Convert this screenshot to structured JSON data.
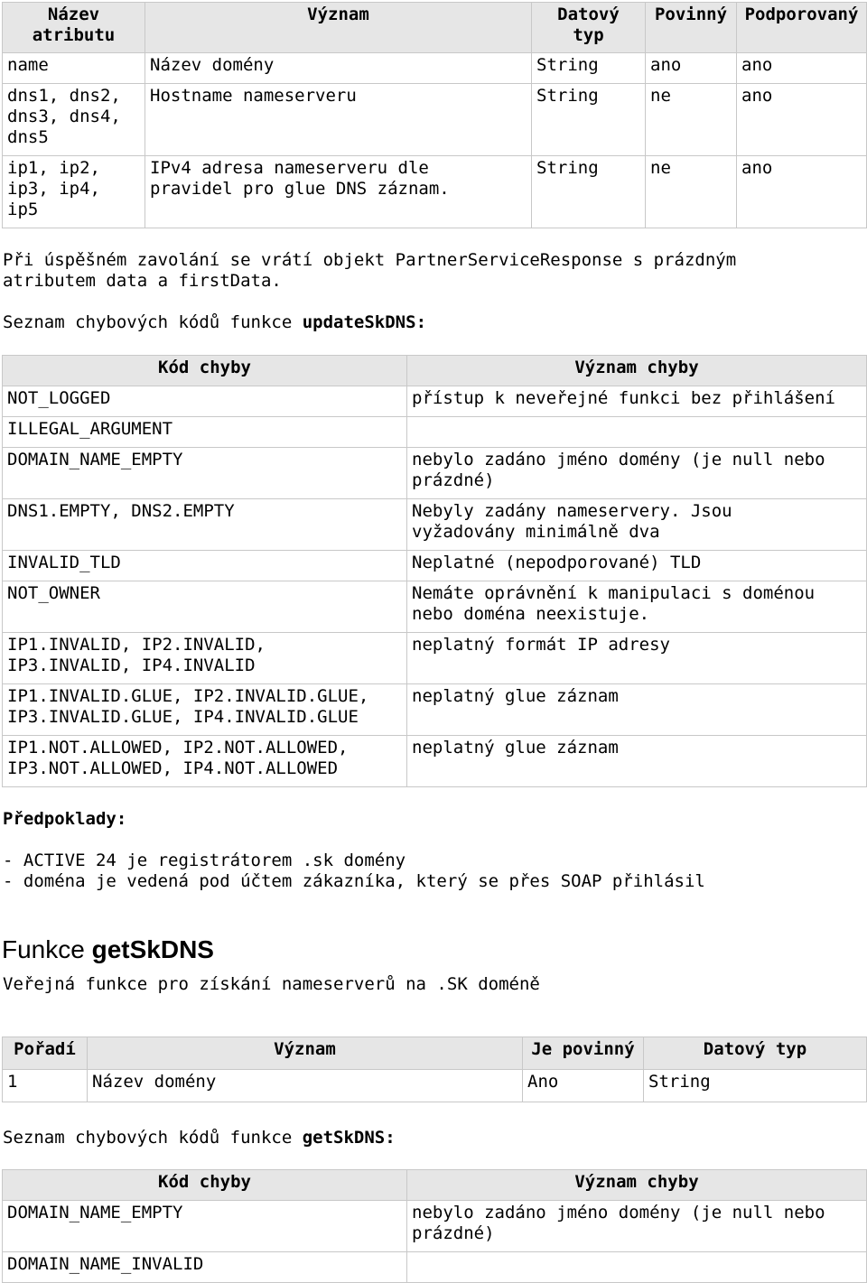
{
  "params_table": {
    "headers": [
      "Název\natributu",
      "Význam",
      "Datový\ntyp",
      "Povinný",
      "Podporovaný"
    ],
    "rows": [
      [
        "name",
        "Název domény",
        "String",
        "ano",
        "ano"
      ],
      [
        "dns1, dns2,\ndns3, dns4,\ndns5",
        "Hostname nameserveru",
        "String",
        "ne",
        "ano"
      ],
      [
        "ip1, ip2,\nip3, ip4,\nip5",
        "IPv4 adresa nameserveru dle\npravidel pro glue DNS záznam.",
        "String",
        "ne",
        "ano"
      ]
    ]
  },
  "success_note": {
    "line1": "Při úspěšném zavolání se vrátí objekt PartnerServiceResponse s prázdným",
    "line2": "atributem data a firstData."
  },
  "update_errors_intro": {
    "prefix": "Seznam chybových kódů funkce ",
    "func": "updateSkDNS:"
  },
  "update_errors_table": {
    "headers": [
      "Kód chyby",
      "Význam chyby"
    ],
    "rows": [
      [
        "NOT_LOGGED",
        "přístup k neveřejné funkci bez přihlášení"
      ],
      [
        "ILLEGAL_ARGUMENT",
        ""
      ],
      [
        "DOMAIN_NAME_EMPTY",
        "nebylo zadáno jméno domény (je null nebo\nprázdné)"
      ],
      [
        "DNS1.EMPTY, DNS2.EMPTY",
        "Nebyly zadány nameservery. Jsou\nvyžadovány minimálně dva"
      ],
      [
        "INVALID_TLD",
        "Neplatné (nepodporované) TLD"
      ],
      [
        "NOT_OWNER",
        "Nemáte oprávnění k manipulaci s doménou\nnebo doména neexistuje."
      ],
      [
        "IP1.INVALID, IP2.INVALID,\nIP3.INVALID, IP4.INVALID",
        "neplatný formát IP adresy"
      ],
      [
        "IP1.INVALID.GLUE, IP2.INVALID.GLUE,\nIP3.INVALID.GLUE, IP4.INVALID.GLUE",
        "neplatný glue záznam"
      ],
      [
        "IP1.NOT.ALLOWED, IP2.NOT.ALLOWED,\nIP3.NOT.ALLOWED, IP4.NOT.ALLOWED",
        "neplatný glue záznam"
      ]
    ]
  },
  "prerequisites": {
    "title": "Předpoklady:",
    "items": [
      "- ACTIVE 24 je registrátorem .sk domény",
      "- doména je vedená pod účtem zákazníka, který se přes SOAP přihlásil"
    ]
  },
  "get_function": {
    "heading_prefix": "Funkce ",
    "heading_name": "getSkDNS",
    "description": "Veřejná funkce pro získání nameserverů na .SK doméně"
  },
  "get_params_table": {
    "headers": [
      "Pořadí",
      "Význam",
      "Je povinný",
      "Datový typ"
    ],
    "rows": [
      [
        "1",
        "Název domény",
        "Ano",
        "String"
      ]
    ]
  },
  "get_errors_intro": {
    "prefix": "Seznam chybových kódů funkce ",
    "func": "getSkDNS:"
  },
  "get_errors_table": {
    "headers": [
      "Kód chyby",
      "Význam chyby"
    ],
    "rows": [
      [
        "DOMAIN_NAME_EMPTY",
        "nebylo zadáno jméno domény (je null nebo\nprázdné)"
      ],
      [
        "DOMAIN_NAME_INVALID",
        ""
      ]
    ]
  }
}
